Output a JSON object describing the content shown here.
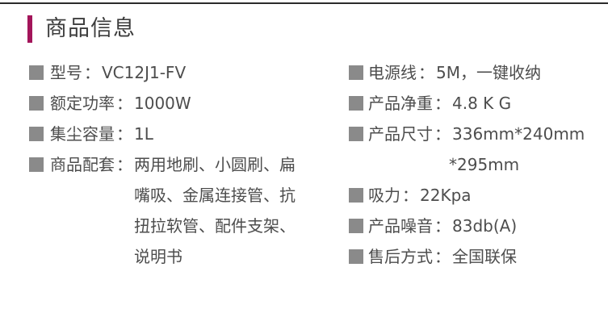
{
  "header": {
    "title": "商品信息",
    "accent_color": "#a3155a"
  },
  "bullet_color": "#8a8a8a",
  "left_specs": [
    {
      "key": "型号",
      "sep": "：",
      "value": "VC12J1-FV"
    },
    {
      "key": "额定功率",
      "sep": "：",
      "value": "1000W"
    },
    {
      "key": "集尘容量",
      "sep": "：",
      "value": "1L"
    },
    {
      "key": "商品配套",
      "sep": "：",
      "lines": [
        "两用地刷、小圆刷、扁",
        "嘴吸、金属连接管、抗",
        "扭拉软管、配件支架、",
        "说明书"
      ]
    }
  ],
  "right_specs": [
    {
      "key": "电源线",
      "sep": "：",
      "value": "5M，一键收纳"
    },
    {
      "key": "产品净重",
      "sep": "：",
      "value": "4.8 K G"
    },
    {
      "key": "产品尺寸",
      "sep": "：",
      "value": "336mm*240mm",
      "continuation": "*295mm"
    },
    {
      "key": "吸力",
      "sep": "：",
      "value": "22Kpa"
    },
    {
      "key": "产品噪音",
      "sep": "：",
      "value": "83db(A)"
    },
    {
      "key": "售后方式",
      "sep": "：",
      "value": "全国联保"
    }
  ]
}
